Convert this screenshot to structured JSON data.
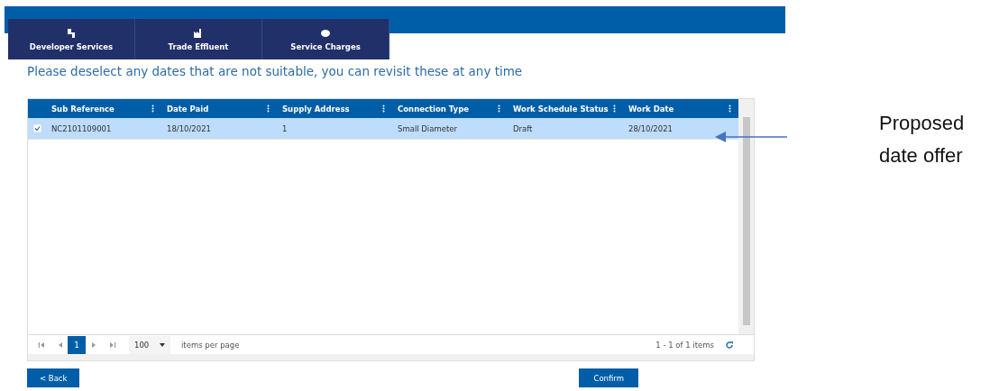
{
  "nav_tabs": [
    {
      "label": "Developer Services"
    },
    {
      "label": "Trade Effluent"
    },
    {
      "label": "Service Charges"
    }
  ],
  "instruction": "Please deselect any dates that are not suitable, you can revisit these at any time",
  "table": {
    "columns": [
      "Sub Reference",
      "Date Paid",
      "Supply Address",
      "Connection Type",
      "Work Schedule Status",
      "Work Date"
    ],
    "rows": [
      {
        "checked": true,
        "selected": true,
        "cells": [
          "NC2101109001",
          "18/10/2021",
          "1",
          "Small Diameter",
          "Draft",
          "28/10/2021"
        ]
      }
    ]
  },
  "pager": {
    "pages": [
      {
        "label": "1",
        "selected": true
      }
    ],
    "page_size": "100",
    "page_size_label": "items per page",
    "summary": "1 - 1 of 1 items"
  },
  "buttons": {
    "back": "< Back",
    "confirm": "Confirm"
  },
  "annotation": {
    "text": "Proposed date offer"
  }
}
